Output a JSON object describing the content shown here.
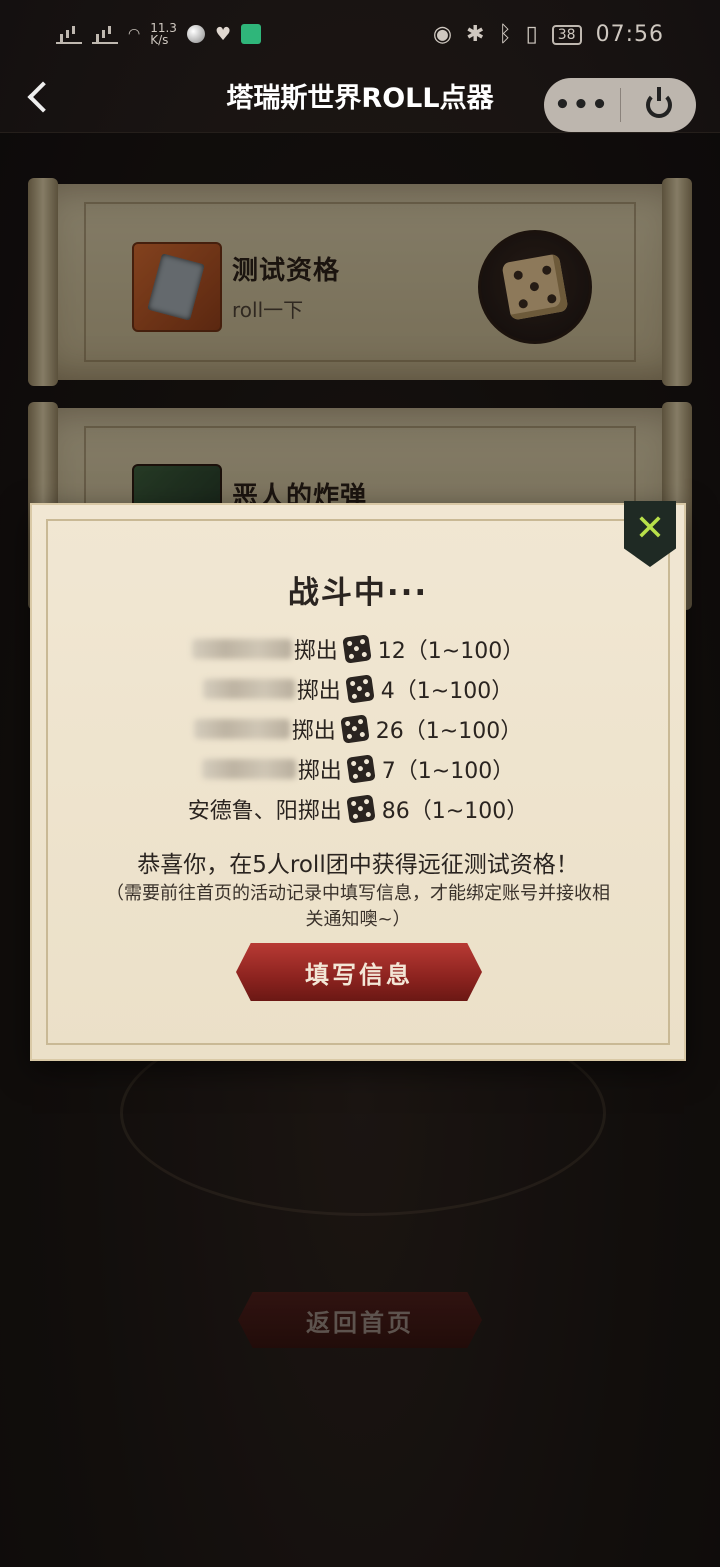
{
  "status_bar": {
    "time": "07:56",
    "network_speed": "11.3\nK/s",
    "battery": "38"
  },
  "nav": {
    "title": "塔瑞斯世界ROLL点器",
    "more_label": "•••"
  },
  "cards": [
    {
      "title": "测试资格",
      "subtitle": "roll一下"
    },
    {
      "title": "恶人的炸弹"
    }
  ],
  "modal": {
    "title": "战斗中···",
    "close_label": "✕",
    "rolls": [
      {
        "name": "",
        "verb": "掷出",
        "value": "12（1~100）"
      },
      {
        "name": "",
        "verb": "掷出",
        "value": "4（1~100）"
      },
      {
        "name": "",
        "verb": "掷出",
        "value": "26（1~100）"
      },
      {
        "name": "",
        "verb": "掷出",
        "value": "7（1~100）"
      },
      {
        "name": "安德鲁、阳",
        "verb": "掷出",
        "value": "86（1~100）"
      }
    ],
    "congrats": "恭喜你，在5人roll团中获得远征测试资格！",
    "note": "（需要前往首页的活动记录中填写信息，才能绑定账号并接收相关通知噢~）",
    "fill_button": "填写信息"
  },
  "home_button": "返回首页"
}
